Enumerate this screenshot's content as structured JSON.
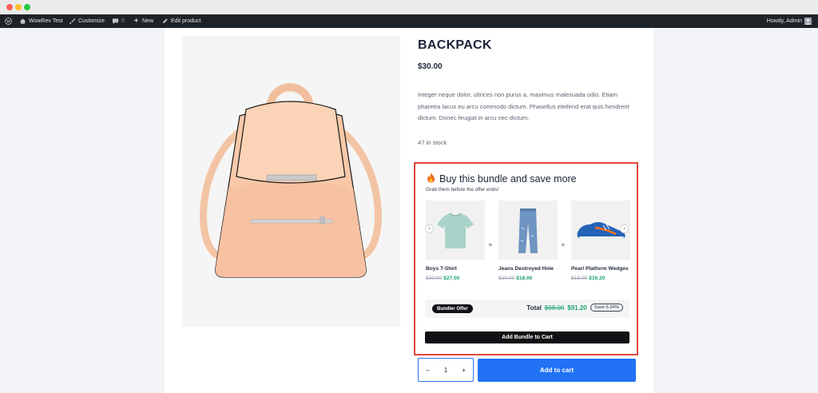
{
  "admin_bar": {
    "site_name": "WowRev Test",
    "customize": "Customize",
    "comments_count": "0",
    "new": "New",
    "edit_product": "Edit product",
    "greeting": "Howdy, Admin"
  },
  "product": {
    "title": "BACKPACK",
    "price": "$30.00",
    "description": "Integer neque dolor, ultrices non purus a, maximus malesuada odio. Etiam pharetra lacus eu arcu commodo dictum. Phasellus eleifend erat quis hendrerit dictum. Donec feugiat in arcu nec dictum.",
    "stock": "47 in stock"
  },
  "bundle": {
    "title": "Buy this bundle and save more",
    "subtitle": "Grab them before the offer ends!",
    "items": [
      {
        "name": "Boys T-Shirt",
        "old_price": "$30.00",
        "new_price": "$27.00",
        "icon": "tshirt-image"
      },
      {
        "name": "Jeans Destroyed Hole",
        "old_price": "$20.00",
        "new_price": "$18.00",
        "icon": "jeans-image"
      },
      {
        "name": "Pearl Platform Wedges",
        "old_price": "$18.00",
        "new_price": "$16.20",
        "icon": "sneaker-image"
      }
    ],
    "badge": "Bundler Offer",
    "total_label": "Total",
    "total_old": "$98.00",
    "total_new": "$91.20",
    "save": "Save 6.94%",
    "add_button": "Add Bundle to Cart"
  },
  "cart": {
    "quantity": "1",
    "minus": "−",
    "plus": "+",
    "add_to_cart": "Add to cart"
  },
  "colors": {
    "admin_bar": "#1d2327",
    "accent_blue": "#2272f5",
    "bundle_border": "#e2463b",
    "discount_green": "#1ea36e"
  }
}
